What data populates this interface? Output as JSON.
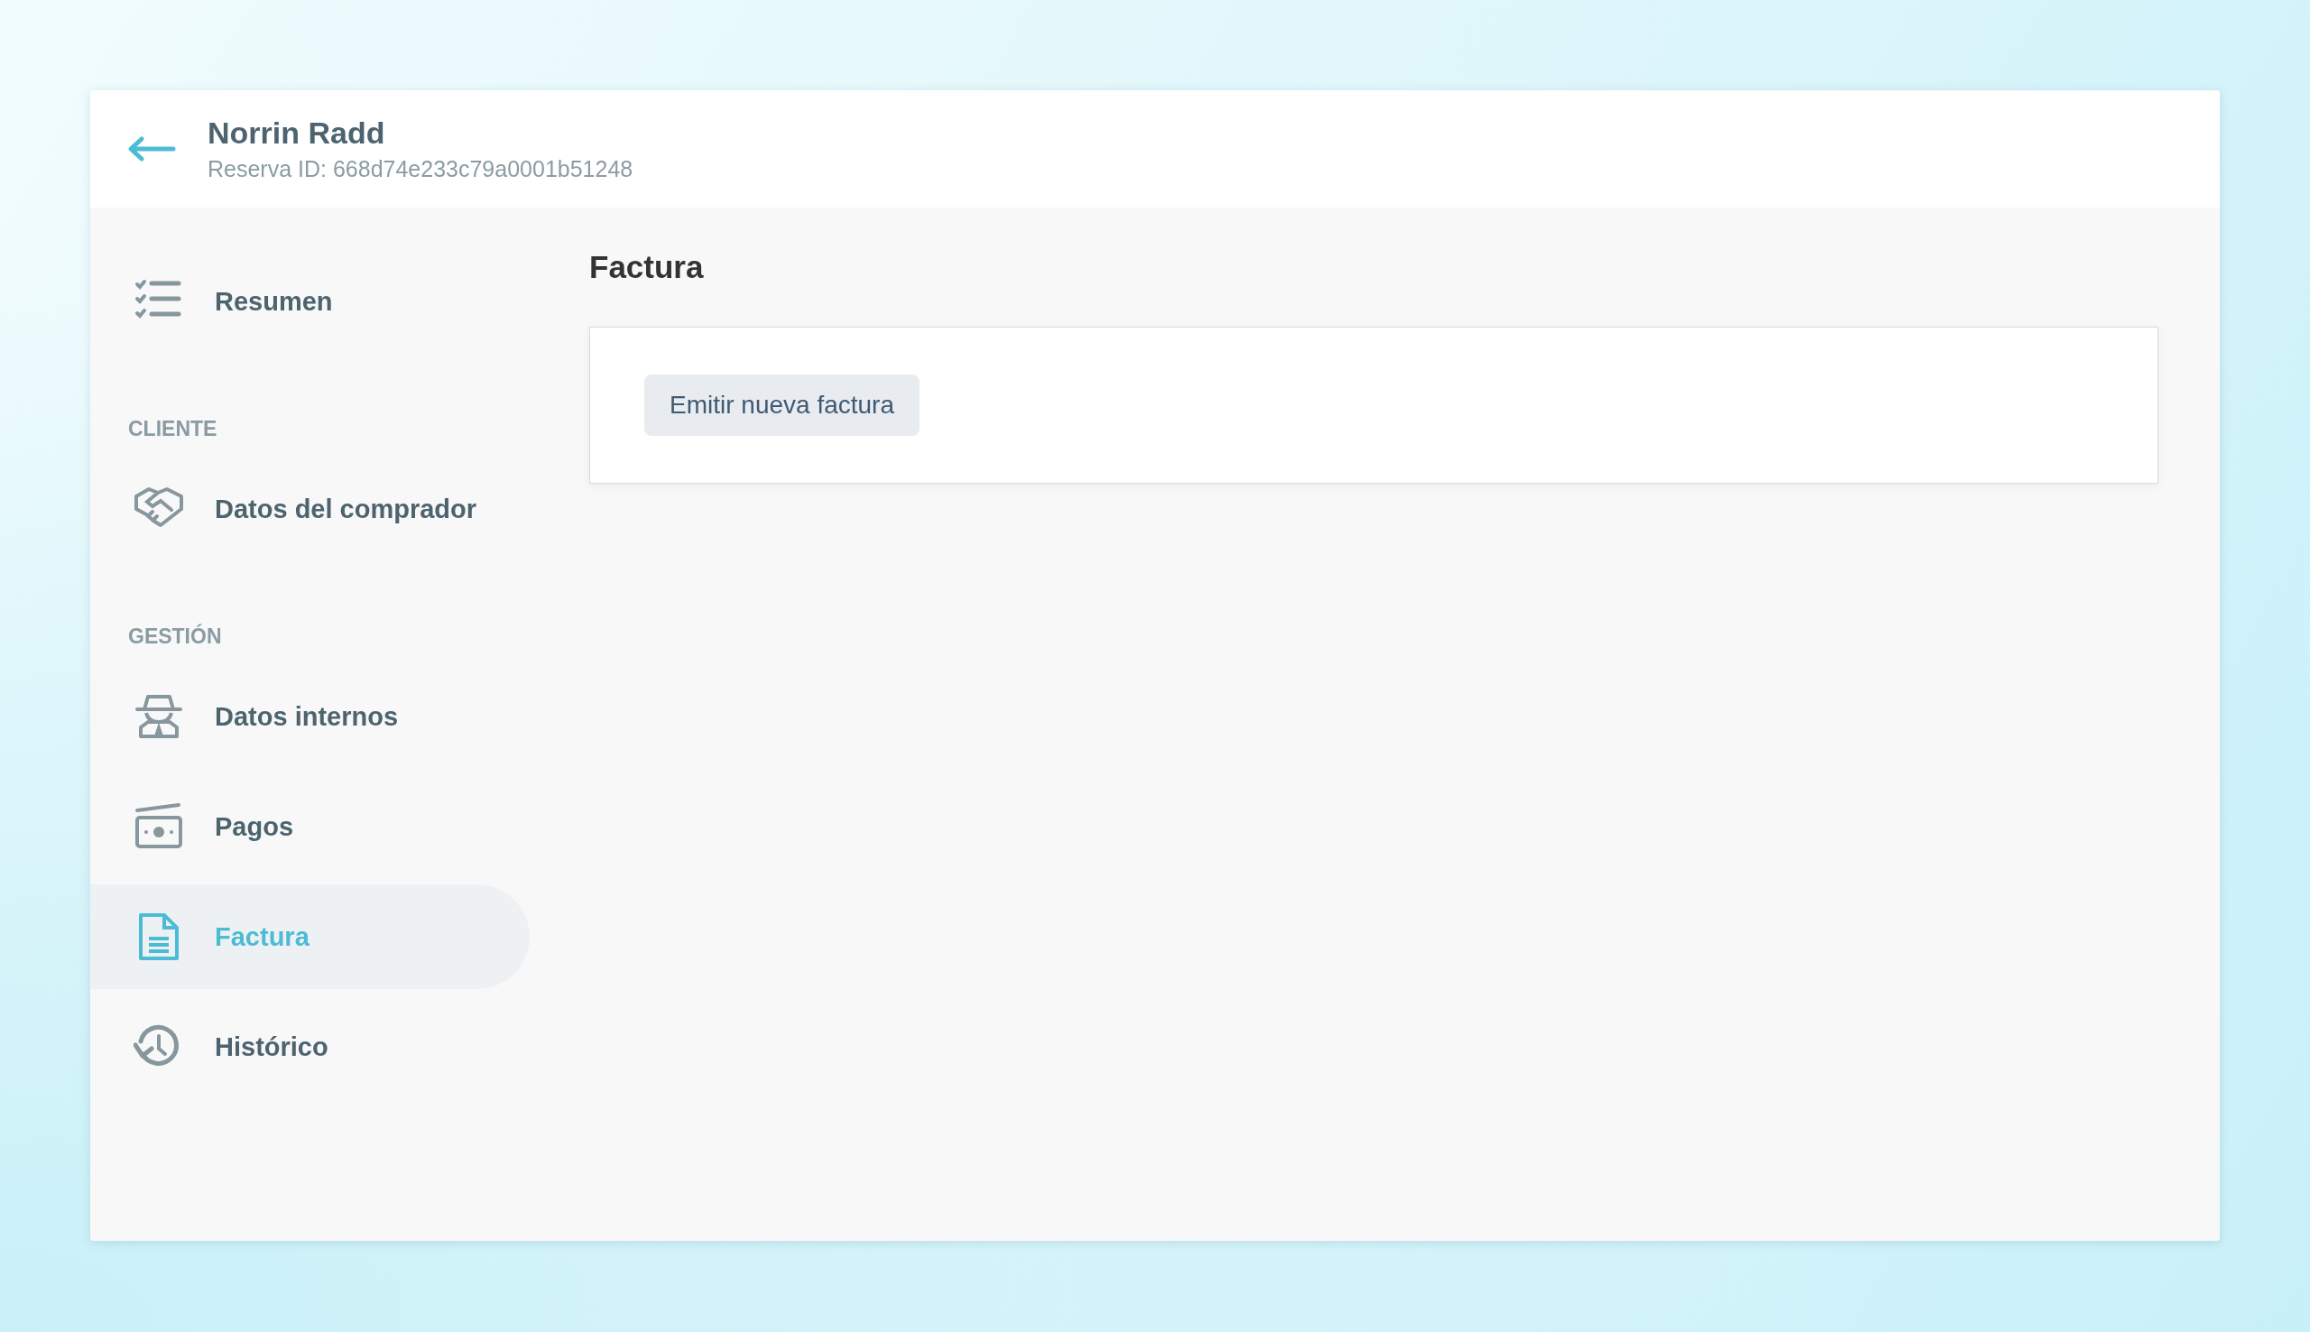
{
  "header": {
    "title": "Norrin Radd",
    "subtitle": "Reserva ID: 668d74e233c79a0001b51248"
  },
  "sidebar": {
    "items": [
      {
        "kind": "item",
        "label": "Resumen",
        "selected": false
      },
      {
        "kind": "heading",
        "label": "CLIENTE"
      },
      {
        "kind": "item",
        "label": "Datos del comprador",
        "selected": false
      },
      {
        "kind": "heading",
        "label": "GESTIÓN"
      },
      {
        "kind": "item",
        "label": "Datos internos",
        "selected": false
      },
      {
        "kind": "item",
        "label": "Pagos",
        "selected": false
      },
      {
        "kind": "item",
        "label": "Factura",
        "selected": true
      },
      {
        "kind": "item",
        "label": "Histórico",
        "selected": false
      }
    ]
  },
  "content": {
    "title": "Factura",
    "button": "Emitir nueva factura"
  }
}
